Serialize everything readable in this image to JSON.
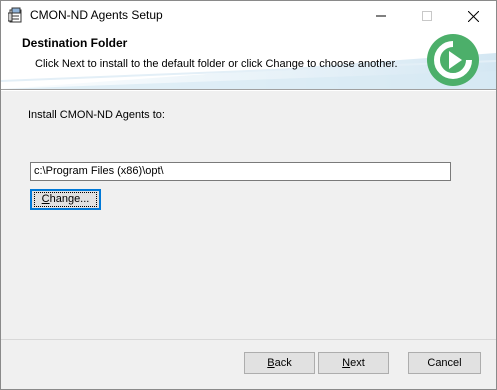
{
  "window": {
    "title": "CMON-ND Agents Setup",
    "controls": {
      "minimize_icon": "minimize-icon",
      "maximize_icon": "maximize-icon",
      "close_icon": "close-icon"
    }
  },
  "banner": {
    "title": "Destination Folder",
    "description": "Click Next to install to the default folder or click Change to choose another.",
    "logo_color": "#4caf6a"
  },
  "content": {
    "install_label": "Install CMON-ND Agents to:",
    "install_path": "c:\\Program Files (x86)\\opt\\",
    "change_button": {
      "prefix": "",
      "mnemonic": "C",
      "rest": "hange..."
    }
  },
  "footer": {
    "back": {
      "mnemonic": "B",
      "rest": "ack"
    },
    "next": {
      "mnemonic": "N",
      "rest": "ext"
    },
    "cancel": "Cancel"
  },
  "colors": {
    "accent": "#0078d7",
    "dialog_bg": "#f0f0f0"
  }
}
